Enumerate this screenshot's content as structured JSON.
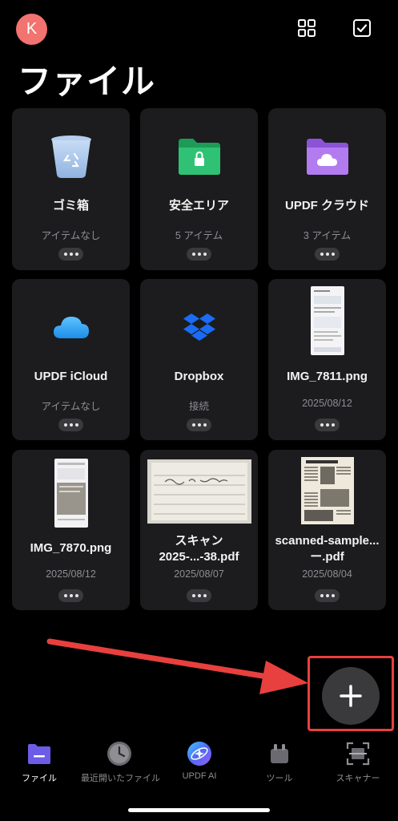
{
  "header": {
    "avatar_letter": "K",
    "title": "ファイル"
  },
  "cards": [
    {
      "name": "ゴミ箱",
      "sub": "アイテムなし",
      "icon": "trash-icon"
    },
    {
      "name": "安全エリア",
      "sub": "5 アイテム",
      "icon": "lock-folder-icon"
    },
    {
      "name": "UPDF クラウド",
      "sub": "3 アイテム",
      "icon": "cloud-folder-icon"
    },
    {
      "name": "UPDF iCloud",
      "sub": "アイテムなし",
      "icon": "icloud-icon"
    },
    {
      "name": "Dropbox",
      "sub": "接続",
      "icon": "dropbox-icon"
    },
    {
      "name": "IMG_7811.png",
      "sub": "2025/08/12",
      "icon": "image-thumbnail"
    },
    {
      "name": "IMG_7870.png",
      "sub": "2025/08/12",
      "icon": "image-thumbnail"
    },
    {
      "name": "スキャン 2025-...-38.pdf",
      "sub": "2025/08/07",
      "icon": "pdf-thumbnail"
    },
    {
      "name": "scanned-sample...ー.pdf",
      "sub": "2025/08/04",
      "icon": "pdf-thumbnail"
    }
  ],
  "nav": [
    {
      "label": "ファイル",
      "icon": "files-icon",
      "active": true
    },
    {
      "label": "最近開いたファイル",
      "icon": "clock-icon"
    },
    {
      "label": "UPDF AI",
      "icon": "ai-icon"
    },
    {
      "label": "ツール",
      "icon": "tools-icon"
    },
    {
      "label": "スキャナー",
      "icon": "scanner-icon"
    }
  ],
  "colors": {
    "accent": "#5b4cdb",
    "annotation": "#e8403e",
    "avatar": "#f2736f"
  }
}
